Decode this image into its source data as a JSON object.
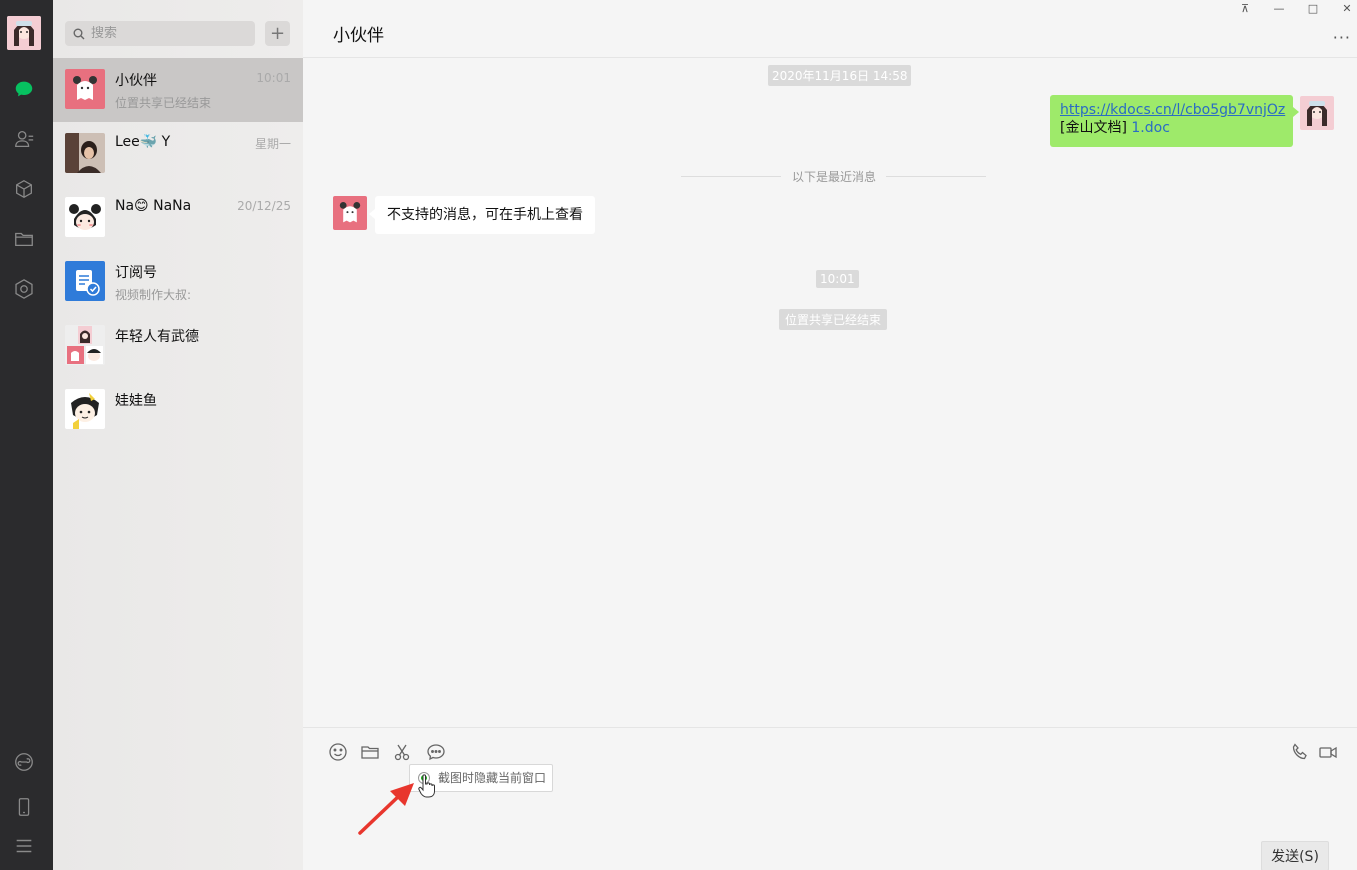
{
  "sidebar": {
    "nav_icons": [
      "chat-icon",
      "contacts-icon",
      "cube-icon",
      "folder-icon",
      "settings-icon",
      "mini-program-icon",
      "phone-icon",
      "menu-icon"
    ],
    "active_color": "#07c160"
  },
  "chat_list": {
    "search_placeholder": "搜索",
    "add_label": "+",
    "items": [
      {
        "name": "小伙伴",
        "preview": "位置共享已经结束",
        "time": "10:01"
      },
      {
        "name": "Lee🐳 Y",
        "preview": "",
        "time": "星期一"
      },
      {
        "name": "Na😊 NaNa",
        "preview": "",
        "time": "20/12/25"
      },
      {
        "name": "订阅号",
        "preview": "视频制作大叔:",
        "time": ""
      },
      {
        "name": "年轻人有武德",
        "preview": "",
        "time": ""
      },
      {
        "name": "娃娃鱼",
        "preview": "",
        "time": ""
      }
    ]
  },
  "window": {
    "pin": "⊼",
    "minimize": "—",
    "maximize": "□",
    "close": "✕"
  },
  "chat": {
    "title": "小伙伴",
    "more": "···",
    "timestamp1": "2020年11月16日 14:58",
    "sent_link": "https://kdocs.cn/l/cbo5gb7vnjOz",
    "sent_doc_prefix": "[金山文档]",
    "sent_doc_name": "1.doc",
    "divider": "以下是最近消息",
    "received_msg": "不支持的消息，可在手机上查看",
    "timestamp2": "10:01",
    "system_msg": "位置共享已经结束"
  },
  "input": {
    "tooltip": "截图时隐藏当前窗口",
    "send": "发送(S)",
    "tools": [
      "emoji-icon",
      "folder-icon",
      "scissors-icon",
      "chat-bubble-icon",
      "phone-call-icon",
      "video-call-icon"
    ]
  }
}
